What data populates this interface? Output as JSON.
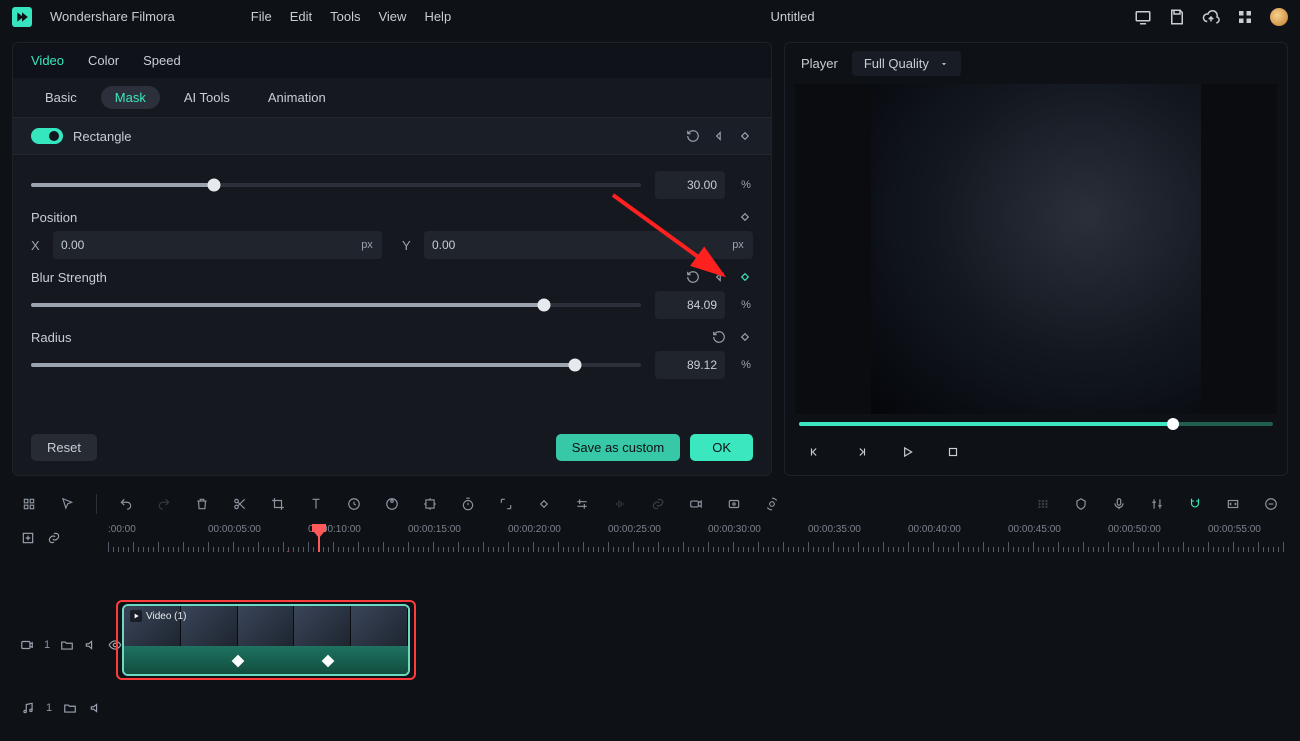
{
  "menubar": {
    "app_name": "Wondershare Filmora",
    "items": [
      "File",
      "Edit",
      "Tools",
      "View",
      "Help"
    ],
    "document_title": "Untitled"
  },
  "left_panel": {
    "primary_tabs": [
      "Video",
      "Color",
      "Speed"
    ],
    "primary_active": "Video",
    "sub_tabs": [
      "Basic",
      "Mask",
      "AI Tools",
      "Animation"
    ],
    "sub_active": "Mask",
    "section_title": "Rectangle",
    "props": {
      "top_slider": {
        "value": "30.00",
        "unit": "%",
        "percent": 30
      },
      "position": {
        "label": "Position",
        "x_label": "X",
        "x_value": "0.00",
        "x_unit": "px",
        "y_label": "Y",
        "y_value": "0.00",
        "y_unit": "px"
      },
      "blur": {
        "label": "Blur Strength",
        "value": "84.09",
        "unit": "%",
        "percent": 84.09
      },
      "radius": {
        "label": "Radius",
        "value": "89.12",
        "unit": "%",
        "percent": 89.12
      }
    },
    "footer": {
      "reset": "Reset",
      "save_custom": "Save as custom",
      "ok": "OK"
    }
  },
  "player": {
    "label": "Player",
    "quality": "Full Quality",
    "progress_percent": 79
  },
  "timeline": {
    "ruler_labels": [
      ":00:00",
      "00:00:05:00",
      "00:00:10:00",
      "00:00:15:00",
      "00:00:20:00",
      "00:00:25:00",
      "00:00:30:00",
      "00:00:35:00",
      "00:00:40:00",
      "00:00:45:00",
      "00:00:50:00",
      "00:00:55:00"
    ],
    "clip_label": "Video (1)",
    "video_track_label": "1",
    "audio_track_label": "1"
  }
}
